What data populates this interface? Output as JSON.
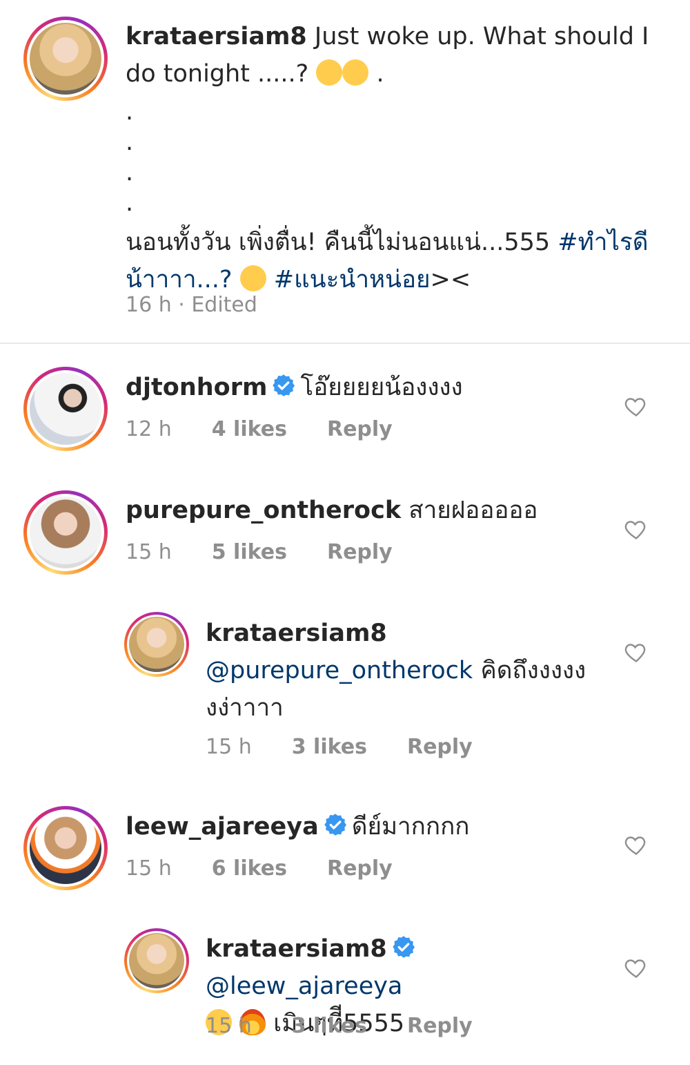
{
  "caption": {
    "username": "krataersiam8",
    "text_line1": "Just woke up. What should I do tonight .....?",
    "trail": ".",
    "dots": [
      ".",
      ".",
      ".",
      "."
    ],
    "thai_text": "นอนทั้งวัน เพิ่งตื่น! คืนนี้ไม่นอนแน่...555",
    "hashtag1": "#ทำไรดีน้าาาา...?",
    "hashtag2": "#แนะนำหน่อย",
    "suffix": "><",
    "meta": "16 h · Edited"
  },
  "comments": [
    {
      "username": "djtonhorm",
      "verified": true,
      "text": "โอ๊ยยยยน้องงงง",
      "time": "12 h",
      "likes": "4 likes",
      "reply": "Reply"
    },
    {
      "username": "purepure_ontherock",
      "verified": false,
      "text": "สายฝอออออ",
      "time": "15 h",
      "likes": "5 likes",
      "reply": "Reply"
    },
    {
      "username": "krataersiam8",
      "verified": false,
      "mention": "@purepure_ontherock",
      "text": "คิดถึงงงงงงง่าาาา",
      "time": "15 h",
      "likes": "3 likes",
      "reply": "Reply"
    },
    {
      "username": "leew_ajareeya",
      "verified": true,
      "text": "ดีย์มากกกก",
      "time": "15 h",
      "likes": "6 likes",
      "reply": "Reply"
    },
    {
      "username": "krataersiam8",
      "verified": true,
      "mention": "@leew_ajareeya",
      "text": "เมินๆทีี5555",
      "time": "15 h",
      "likes": "3 likes",
      "reply": "Reply"
    }
  ],
  "colors": {
    "verified": "#3897f0",
    "link": "#00376b",
    "meta": "#8e8e8e"
  }
}
